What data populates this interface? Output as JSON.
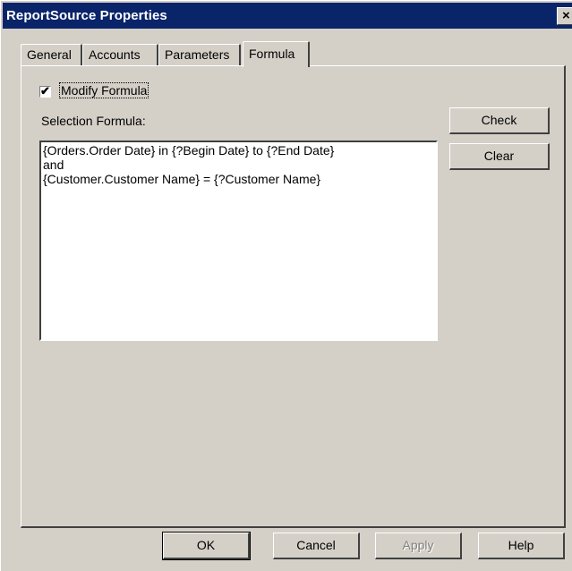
{
  "window": {
    "title": "ReportSource Properties",
    "close_glyph": "×"
  },
  "tabs": [
    {
      "label": "General",
      "active": false
    },
    {
      "label": "Accounts",
      "active": false
    },
    {
      "label": "Parameters",
      "active": false
    },
    {
      "label": "Formula",
      "active": true
    }
  ],
  "formula_tab": {
    "modify_checkbox": {
      "label": "Modify Formula",
      "checked": true,
      "check_glyph": "✔"
    },
    "selection_label": "Selection Formula:",
    "formula_lines": [
      "{Orders.Order Date} in {?Begin Date} to {?End Date}",
      "and",
      "{Customer.Customer Name} = {?Customer Name}"
    ],
    "check_button": "Check",
    "clear_button": "Clear"
  },
  "footer": {
    "ok": "OK",
    "cancel": "Cancel",
    "apply": "Apply",
    "help": "Help"
  }
}
